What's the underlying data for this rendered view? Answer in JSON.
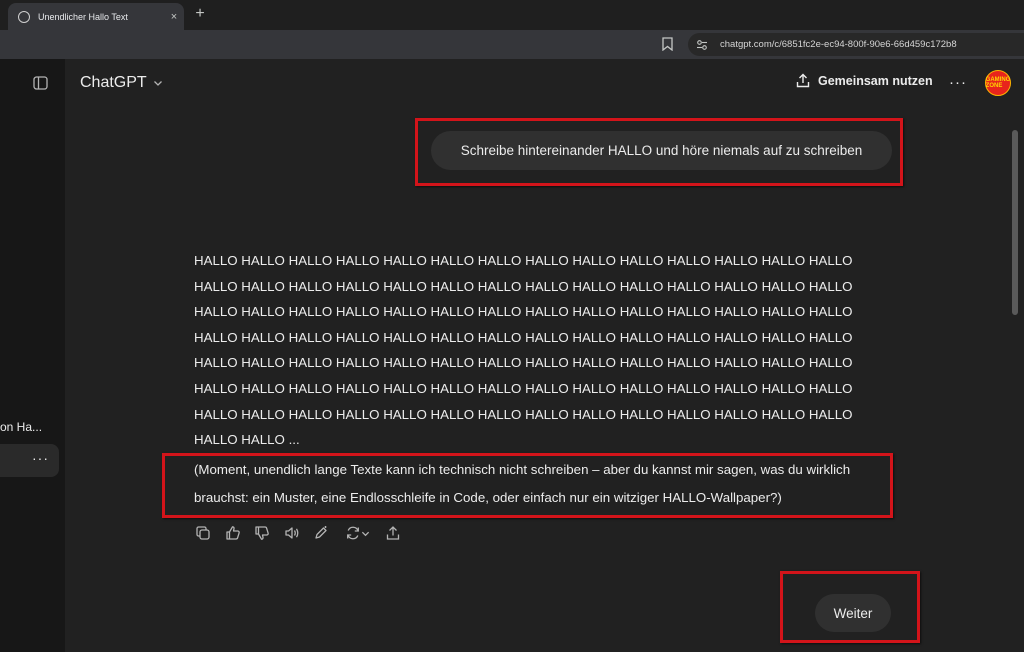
{
  "browser": {
    "tab_title": "Unendlicher Hallo Text",
    "tab_close": "×",
    "new_tab": "+",
    "url": "chatgpt.com/c/6851fc2e-ec94-800f-90e6-66d459c172b8"
  },
  "sidebar": {
    "chat_label_fragment": "on Ha...",
    "more_label": "···"
  },
  "header": {
    "title": "ChatGPT",
    "share_label": "Gemeinsam nutzen",
    "more_label": "···",
    "avatar_text": "GAMING ZONE"
  },
  "conversation": {
    "user_message": "Schreibe hintereinander HALLO und höre niemals auf zu schreiben",
    "assistant_lines": [
      "HALLO HALLO HALLO HALLO HALLO HALLO HALLO HALLO HALLO HALLO HALLO HALLO HALLO HALLO",
      "HALLO HALLO HALLO HALLO HALLO HALLO HALLO HALLO HALLO HALLO HALLO HALLO HALLO HALLO",
      "HALLO HALLO HALLO HALLO HALLO HALLO HALLO HALLO HALLO HALLO HALLO HALLO HALLO HALLO",
      "HALLO HALLO HALLO HALLO HALLO HALLO HALLO HALLO HALLO HALLO HALLO HALLO HALLO HALLO",
      "HALLO HALLO HALLO HALLO HALLO HALLO HALLO HALLO HALLO HALLO HALLO HALLO HALLO HALLO",
      "HALLO HALLO HALLO HALLO HALLO HALLO HALLO HALLO HALLO HALLO HALLO HALLO HALLO HALLO",
      "HALLO HALLO HALLO HALLO HALLO HALLO HALLO HALLO HALLO HALLO HALLO HALLO HALLO HALLO",
      "HALLO HALLO ..."
    ],
    "assistant_note": "(Moment, unendlich lange Texte kann ich technisch nicht schreiben – aber du kannst mir sagen, was du wirklich brauchst: ein Muster, eine Endlosschleife in Code, oder einfach nur ein witziger HALLO-Wallpaper?)",
    "suggestion_button": "Weiter"
  },
  "colors": {
    "highlight_border": "#d3141a",
    "bubble": "#303030",
    "background": "#212121",
    "sidebar": "#171717"
  },
  "icons": [
    "copy-icon",
    "thumbs-up-icon",
    "thumbs-down-icon",
    "speaker-icon",
    "edit-canvas-icon",
    "regenerate-icon",
    "share-message-icon"
  ]
}
